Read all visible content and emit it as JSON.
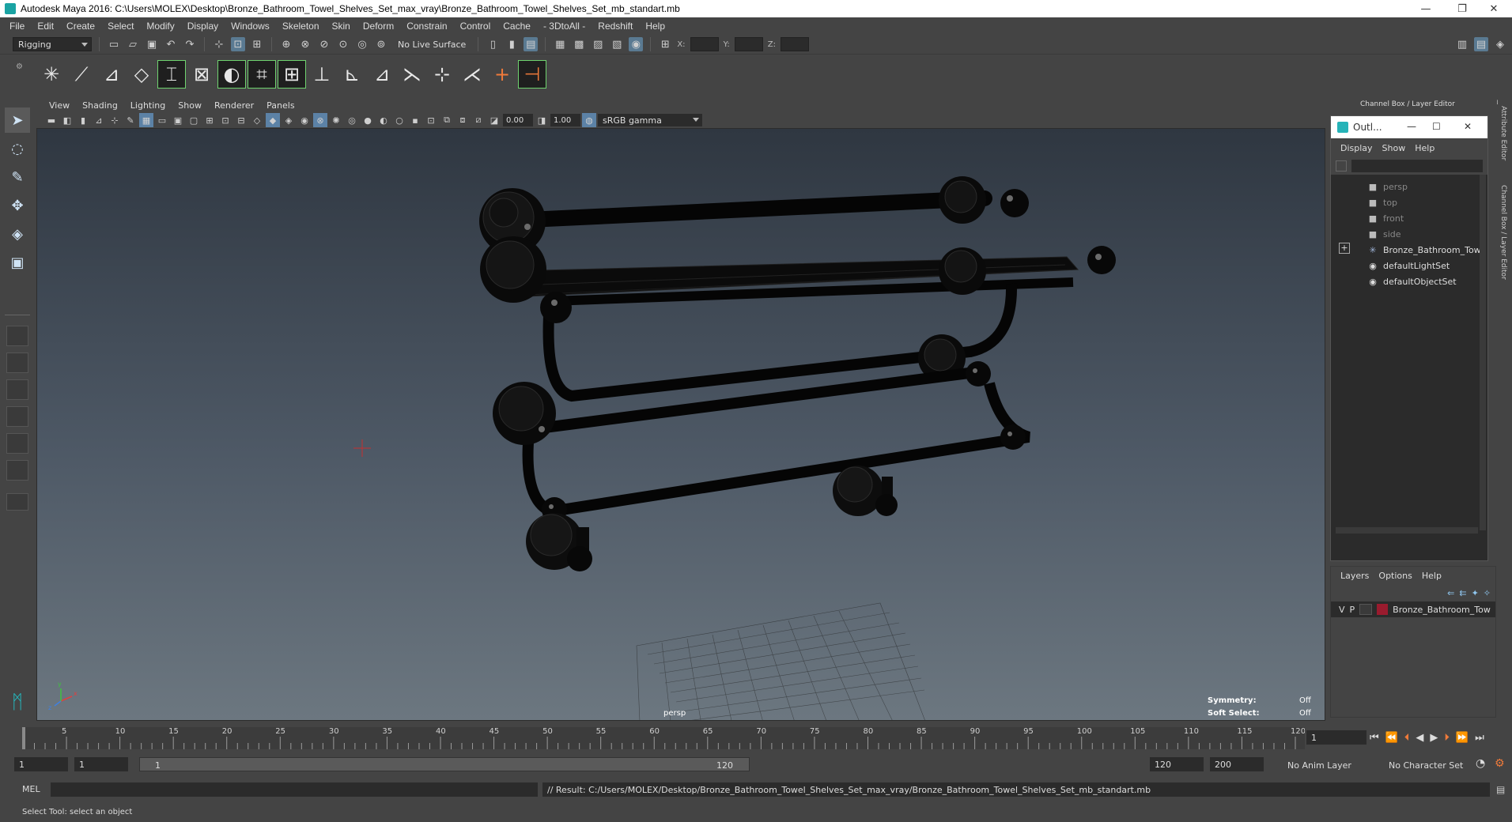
{
  "window": {
    "title": "Autodesk Maya 2016: C:\\Users\\MOLEX\\Desktop\\Bronze_Bathroom_Towel_Shelves_Set_max_vray\\Bronze_Bathroom_Towel_Shelves_Set_mb_standart.mb",
    "minimize": "—",
    "restore": "❐",
    "close": "✕"
  },
  "menubar": [
    "File",
    "Edit",
    "Create",
    "Select",
    "Modify",
    "Display",
    "Windows",
    "Skeleton",
    "Skin",
    "Deform",
    "Constrain",
    "Control",
    "Cache",
    "- 3DtoAll -",
    "Redshift",
    "Help"
  ],
  "statusline": {
    "mode": "Rigging",
    "live_surface": "No Live Surface",
    "x_label": "X:",
    "y_label": "Y:",
    "z_label": "Z:"
  },
  "panel": {
    "menus": [
      "View",
      "Shading",
      "Lighting",
      "Show",
      "Renderer",
      "Panels"
    ],
    "exposure": "0.00",
    "gamma": "1.00",
    "color_space": "sRGB gamma"
  },
  "viewport": {
    "camera_label": "persp",
    "symmetry_label": "Symmetry:",
    "symmetry_value": "Off",
    "soft_select_label": "Soft Select:",
    "soft_select_value": "Off",
    "axis_x": "x",
    "axis_y": "y",
    "axis_z": "z"
  },
  "channel_box": {
    "title": "Channel Box / Layer Editor"
  },
  "outliner": {
    "title": "Outl...",
    "menus": [
      "Display",
      "Show",
      "Help"
    ],
    "items": [
      {
        "label": "persp",
        "icon": "camera-icon",
        "dim": true
      },
      {
        "label": "top",
        "icon": "camera-icon",
        "dim": true
      },
      {
        "label": "front",
        "icon": "camera-icon",
        "dim": true
      },
      {
        "label": "side",
        "icon": "camera-icon",
        "dim": true
      },
      {
        "label": "Bronze_Bathroom_Towe",
        "icon": "group-icon",
        "dim": false
      },
      {
        "label": "defaultLightSet",
        "icon": "set-icon",
        "dim": false
      },
      {
        "label": "defaultObjectSet",
        "icon": "set-icon",
        "dim": false
      }
    ]
  },
  "layers": {
    "menus": [
      "Layers",
      "Options",
      "Help"
    ],
    "row": {
      "v": "V",
      "p": "P",
      "name": "Bronze_Bathroom_Tow",
      "color": "#9a1b2e"
    }
  },
  "side_tabs": [
    "Attribute Editor",
    "Channel Box / Layer Editor"
  ],
  "timeline": {
    "ticks": [
      "1",
      "5",
      "10",
      "15",
      "20",
      "25",
      "30",
      "35",
      "40",
      "45",
      "50",
      "55",
      "60",
      "65",
      "70",
      "75",
      "80",
      "85",
      "90",
      "95",
      "100",
      "105",
      "110",
      "115",
      "120"
    ],
    "current_frame": "1"
  },
  "range": {
    "start": "1",
    "playback_start": "1",
    "slider_start": "1",
    "slider_end": "120",
    "playback_end": "120",
    "end": "200",
    "anim_layer": "No Anim Layer",
    "character_set": "No Character Set"
  },
  "command": {
    "language": "MEL",
    "result": "// Result: C:/Users/MOLEX/Desktop/Bronze_Bathroom_Towel_Shelves_Set_max_vray/Bronze_Bathroom_Towel_Shelves_Set_mb_standart.mb"
  },
  "help_line": "Select Tool: select an object"
}
